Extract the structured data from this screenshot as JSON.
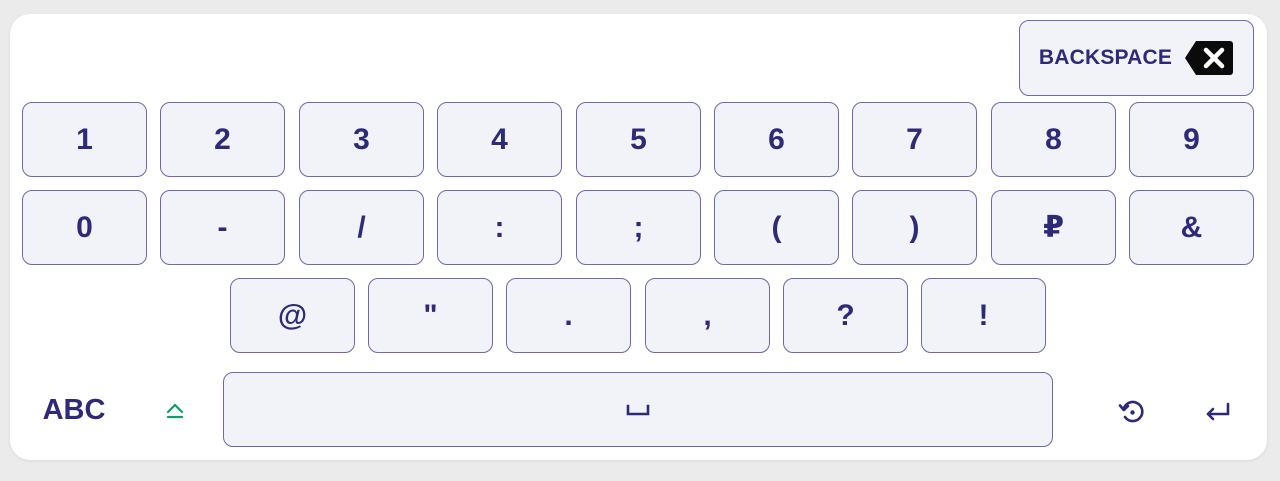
{
  "keyboard": {
    "backspace_label": "BACKSPACE",
    "rows": [
      [
        "1",
        "2",
        "3",
        "4",
        "5",
        "6",
        "7",
        "8",
        "9"
      ],
      [
        "0",
        "-",
        "/",
        ":",
        ";",
        "(",
        ")",
        "₽",
        "&"
      ],
      [
        "@",
        "\"",
        ".",
        ",",
        "?",
        "!"
      ]
    ],
    "abc_label": "ABC",
    "icons": {
      "backspace": "backspace-icon",
      "shift": "shift-icon",
      "space": "space-icon",
      "reset": "rotate-left-icon",
      "enter": "enter-icon"
    },
    "colors": {
      "text": "#2e2a7a",
      "key_border": "#6b68b4",
      "key_bg": "#f1f3f9",
      "shift_accent": "#0aa06e"
    }
  }
}
